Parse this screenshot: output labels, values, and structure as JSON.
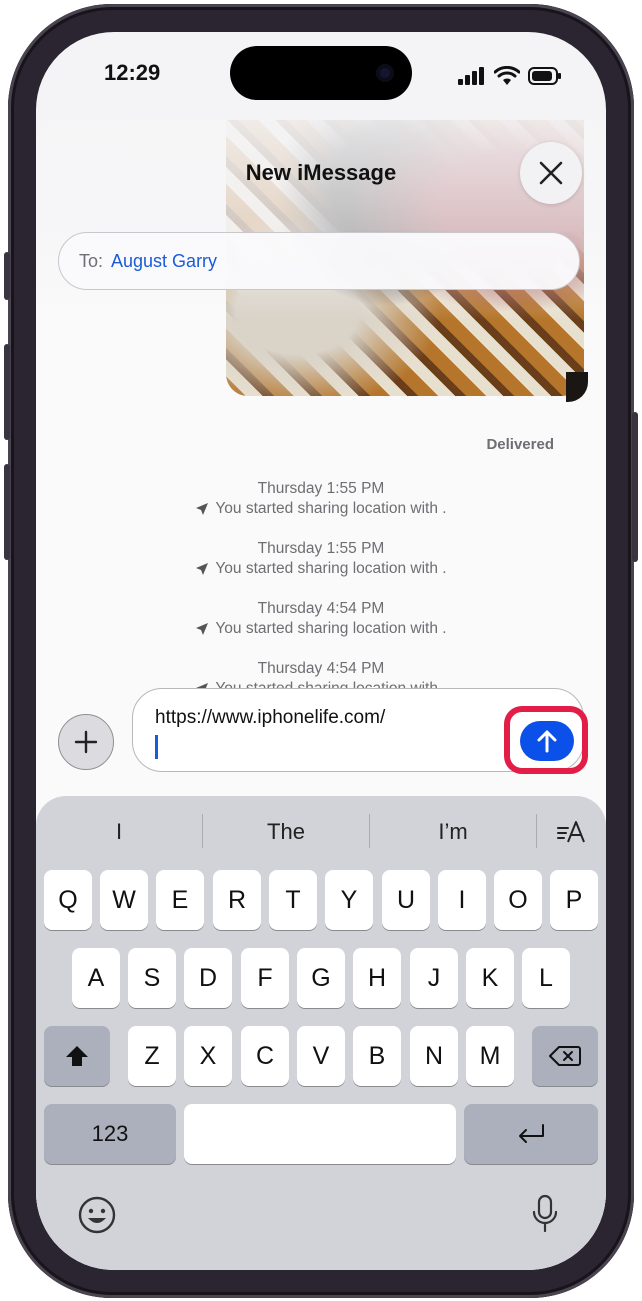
{
  "status": {
    "time": "12:29"
  },
  "sheet": {
    "title": "New iMessage",
    "to_label": "To:",
    "recipient": "August Garry",
    "delivered": "Delivered"
  },
  "messages": [
    {
      "timestamp": "Thursday 1:55 PM",
      "text": "You started sharing location with ."
    },
    {
      "timestamp": "Thursday 1:55 PM",
      "text": "You started sharing location with ."
    },
    {
      "timestamp": "Thursday 4:54 PM",
      "text": "You started sharing location with ."
    },
    {
      "timestamp": "Thursday 4:54 PM",
      "text": "You started sharing location with ."
    }
  ],
  "compose": {
    "text": "https://www.iphonelife.com/"
  },
  "keyboard": {
    "suggestions": [
      "I",
      "The",
      "I’m"
    ],
    "row1": [
      "Q",
      "W",
      "E",
      "R",
      "T",
      "Y",
      "U",
      "I",
      "O",
      "P"
    ],
    "row2": [
      "A",
      "S",
      "D",
      "F",
      "G",
      "H",
      "J",
      "K",
      "L"
    ],
    "row3": [
      "Z",
      "X",
      "C",
      "V",
      "B",
      "N",
      "M"
    ],
    "numbers_label": "123"
  },
  "colors": {
    "accent": "#0b50e8",
    "highlight": "#e11d48",
    "link": "#1a5bd6"
  },
  "icons": {
    "close": "close-icon",
    "plus": "plus-icon",
    "send": "arrow-up-icon",
    "location": "location-arrow-icon",
    "shift": "shift-icon",
    "delete": "delete-icon",
    "return": "return-icon",
    "emoji": "emoji-icon",
    "mic": "microphone-icon",
    "format": "text-format-icon"
  }
}
